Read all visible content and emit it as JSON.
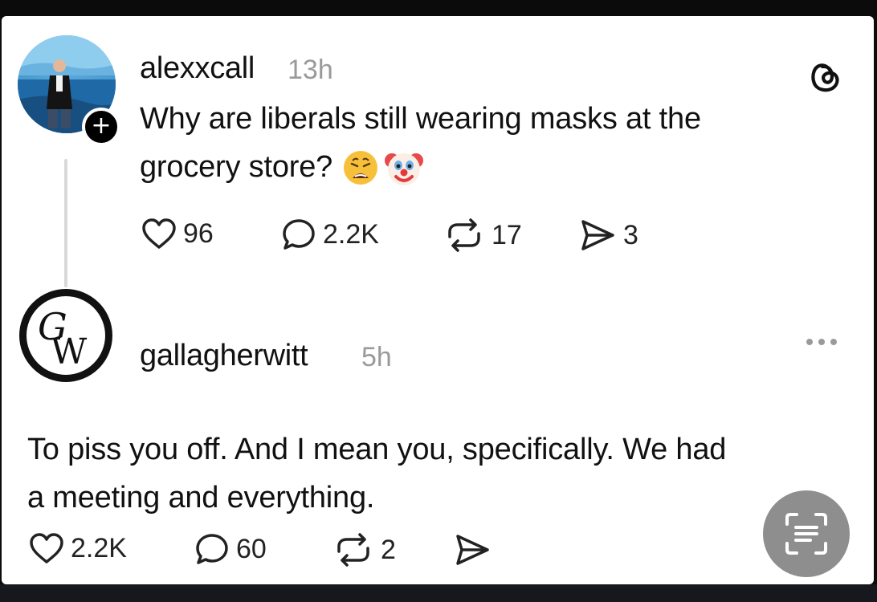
{
  "post": {
    "username": "alexxcall",
    "time": "13h",
    "text_line1": "Why are liberals still wearing masks at the",
    "text_line2": "grocery store?",
    "emojis": [
      "weary-face-emoji",
      "clown-face-emoji"
    ],
    "likes": "96",
    "replies": "2.2K",
    "reposts": "17",
    "shares": "3"
  },
  "reply": {
    "username": "gallagherwitt",
    "time": "5h",
    "avatar_monogram": "GW",
    "text_line1": "To piss you off. And I mean you, specifically. We had",
    "text_line2": "a meeting and everything.",
    "likes": "2.2K",
    "replies": "60",
    "reposts": "2"
  },
  "icons": {
    "like": "heart-icon",
    "reply": "speech-bubble-icon",
    "repost": "repost-icon",
    "share": "send-icon",
    "app": "threads-logo-icon",
    "more": "more-icon",
    "scan": "scan-text-icon"
  },
  "colors": {
    "text": "#111111",
    "muted": "#9a9a9a",
    "background": "#ffffff",
    "thread_line": "#d9d9d9"
  }
}
